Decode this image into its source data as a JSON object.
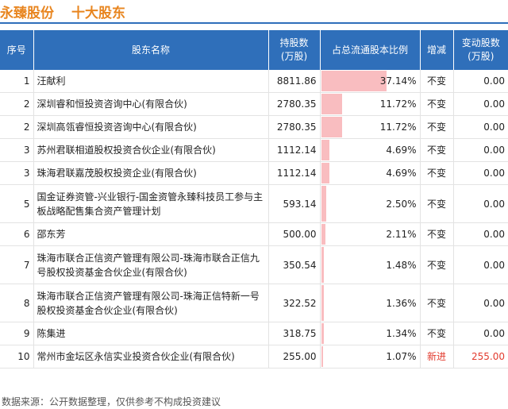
{
  "header": {
    "company": "永臻股份",
    "subtitle": "十大股东"
  },
  "table": {
    "headers": {
      "rank": "序号",
      "name": "股东名称",
      "shares_line1": "持股数",
      "shares_line2": "(万股)",
      "ratio": "占总流通股本比例",
      "change": "增减",
      "delta_line1": "变动股数",
      "delta_line2": "(万股)"
    },
    "rows": [
      {
        "rank": "1",
        "name": "汪献利",
        "shares": "8811.86",
        "ratio": "37.14%",
        "ratio_value": 37.14,
        "change": "不变",
        "delta": "0.00"
      },
      {
        "rank": "2",
        "name": "深圳睿和恒投资咨询中心(有限合伙)",
        "shares": "2780.35",
        "ratio": "11.72%",
        "ratio_value": 11.72,
        "change": "不变",
        "delta": "0.00"
      },
      {
        "rank": "2",
        "name": "深圳高瓴睿恒投资咨询中心(有限合伙)",
        "shares": "2780.35",
        "ratio": "11.72%",
        "ratio_value": 11.72,
        "change": "不变",
        "delta": "0.00"
      },
      {
        "rank": "3",
        "name": "苏州君联相道股权投资合伙企业(有限合伙)",
        "shares": "1112.14",
        "ratio": "4.69%",
        "ratio_value": 4.69,
        "change": "不变",
        "delta": "0.00"
      },
      {
        "rank": "3",
        "name": "珠海君联嘉茂股权投资企业(有限合伙)",
        "shares": "1112.14",
        "ratio": "4.69%",
        "ratio_value": 4.69,
        "change": "不变",
        "delta": "0.00"
      },
      {
        "rank": "5",
        "name": "国金证券资管-兴业银行-国金资管永臻科技员工参与主板战略配售集合资产管理计划",
        "shares": "593.14",
        "ratio": "2.50%",
        "ratio_value": 2.5,
        "change": "不变",
        "delta": "0.00"
      },
      {
        "rank": "6",
        "name": "邵东芳",
        "shares": "500.00",
        "ratio": "2.11%",
        "ratio_value": 2.11,
        "change": "不变",
        "delta": "0.00"
      },
      {
        "rank": "7",
        "name": "珠海市联合正信资产管理有限公司-珠海市联合正信九号股权投资基金合伙企业(有限合伙)",
        "shares": "350.54",
        "ratio": "1.48%",
        "ratio_value": 1.48,
        "change": "不变",
        "delta": "0.00"
      },
      {
        "rank": "8",
        "name": "珠海市联合正信资产管理有限公司-珠海正信特新一号股权投资基金合伙企业(有限合伙)",
        "shares": "322.52",
        "ratio": "1.36%",
        "ratio_value": 1.36,
        "change": "不变",
        "delta": "0.00"
      },
      {
        "rank": "9",
        "name": "陈集进",
        "shares": "318.75",
        "ratio": "1.34%",
        "ratio_value": 1.34,
        "change": "不变",
        "delta": "0.00"
      },
      {
        "rank": "10",
        "name": "常州市金坛区永信实业投资合伙企业(有限合伙)",
        "shares": "255.00",
        "ratio": "1.07%",
        "ratio_value": 1.07,
        "change": "新进",
        "delta": "255.00"
      }
    ]
  },
  "footer": {
    "source": "数据来源：公开数据整理，仅供参考不构成投资建议"
  },
  "colors": {
    "accent_orange": "#e8851f",
    "header_blue": "#2f6fba",
    "bar_pink": "#f9bdc0",
    "new_red": "#e23b2e"
  }
}
